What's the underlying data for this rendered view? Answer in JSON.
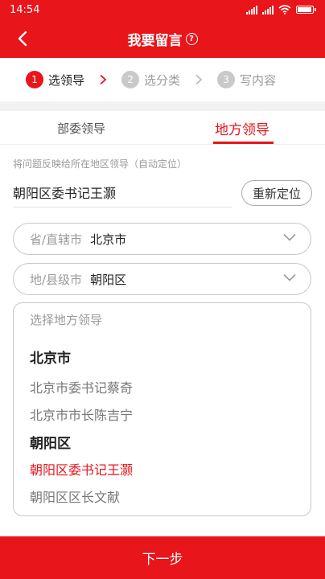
{
  "status_bar": {
    "time": "14:54"
  },
  "nav": {
    "title": "我要留言",
    "help_glyph": "?"
  },
  "steps": [
    {
      "num": "1",
      "label": "选领导"
    },
    {
      "num": "2",
      "label": "选分类"
    },
    {
      "num": "3",
      "label": "写内容"
    }
  ],
  "tabs": [
    {
      "label": "部委领导"
    },
    {
      "label": "地方领导"
    }
  ],
  "hint": "将问题反映给所在地区领导（自动定位）",
  "location": {
    "text": "朝阳区委书记王灏",
    "relocate_label": "重新定位"
  },
  "province_select": {
    "label": "省/直辖市",
    "value": "北京市"
  },
  "city_select": {
    "label": "地/县级市",
    "value": "朝阳区"
  },
  "leaders": {
    "placeholder": "选择地方领导",
    "groups": [
      {
        "title": "北京市",
        "items": [
          "北京市委书记蔡奇",
          "北京市市长陈吉宁"
        ]
      },
      {
        "title": "朝阳区",
        "items": [
          "朝阳区委书记王灏",
          "朝阳区区长文献"
        ]
      }
    ],
    "selected": "朝阳区委书记王灏"
  },
  "next_label": "下一步",
  "colors": {
    "brand_red": "#e8151b",
    "muted_gray": "#9a9a9a"
  },
  "icons": {
    "back": "chevron-left-icon",
    "step_separator": "chevron-right-icon",
    "dropdown": "chevron-down-icon"
  }
}
